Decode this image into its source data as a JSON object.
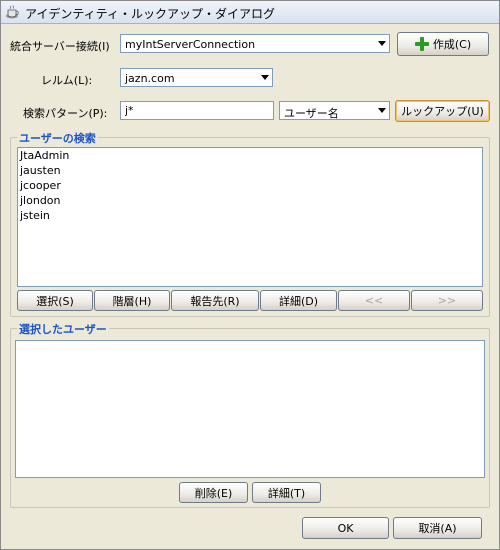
{
  "window": {
    "title": "アイデンティティ・ルックアップ・ダイアログ"
  },
  "form": {
    "connection_label": "統合サーバー接続(I)",
    "connection_value": "myIntServerConnection",
    "create_button": "作成(C)",
    "realm_label": "レルム(L):",
    "realm_value": "jazn.com",
    "pattern_label": "検索パターン(P):",
    "pattern_value": "j*",
    "search_field_value": "ユーザー名",
    "lookup_button": "ルックアップ(U)"
  },
  "search_group": {
    "title": "ユーザーの検索",
    "users": [
      "JtaAdmin",
      "jausten",
      "jcooper",
      "jlondon",
      "jstein"
    ],
    "buttons": {
      "select": "選択(S)",
      "hierarchy": "階層(H)",
      "reports_to": "報告先(R)",
      "details": "詳細(D)",
      "prev": "<<",
      "next": ">>"
    }
  },
  "selected_group": {
    "title": "選択したユーザー",
    "buttons": {
      "delete": "削除(E)",
      "details": "詳細(T)"
    }
  },
  "footer": {
    "ok": "OK",
    "cancel": "取消(A)"
  },
  "colors": {
    "group_title": "#1c54c9",
    "plus": "#2c9a24"
  }
}
